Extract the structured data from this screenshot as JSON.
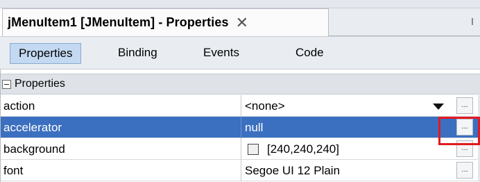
{
  "window": {
    "tab_title": "jMenuItem1 [JMenuItem] - Properties",
    "close_glyph": "✕"
  },
  "subtabs": [
    {
      "label": "Properties",
      "active": true
    },
    {
      "label": "Binding",
      "active": false
    },
    {
      "label": "Events",
      "active": false
    },
    {
      "label": "Code",
      "active": false
    }
  ],
  "sheet": {
    "category_label": "Properties",
    "rows": [
      {
        "name": "action",
        "value": "<none>",
        "has_dropdown": true,
        "has_dots": true
      },
      {
        "name": "accelerator",
        "value": "null",
        "selected": true,
        "has_dots": true
      },
      {
        "name": "background",
        "value": "[240,240,240]",
        "has_swatch": true,
        "has_dots": true
      },
      {
        "name": "font",
        "value": "Segoe UI 12 Plain",
        "has_dots": true
      }
    ],
    "dots_label": "..."
  },
  "colors": {
    "selected_row": "#3b6fc0",
    "highlight_border": "#e31920",
    "active_subtab": "#c3d9f1"
  }
}
